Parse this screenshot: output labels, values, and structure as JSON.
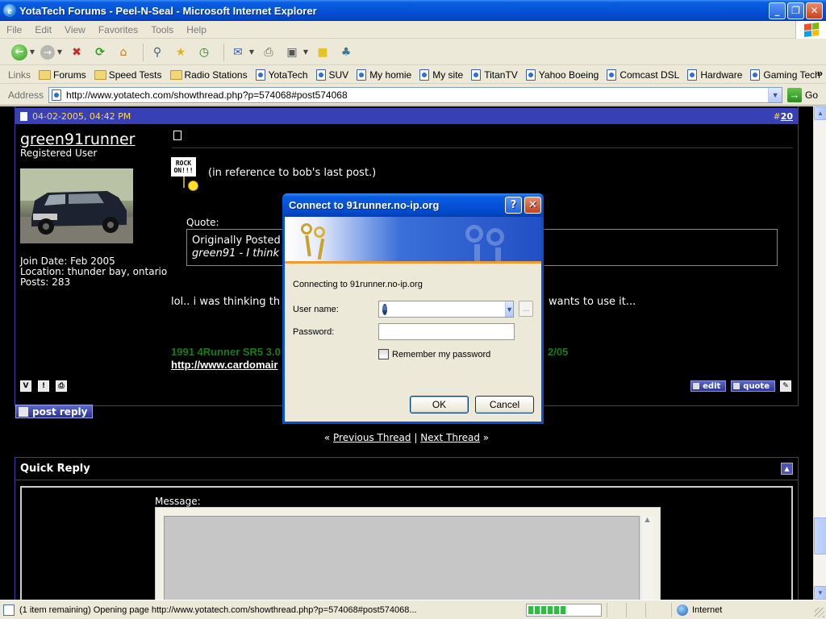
{
  "window": {
    "title": "YotaTech Forums - Peel-N-Seal - Microsoft Internet Explorer"
  },
  "menu": [
    "File",
    "Edit",
    "View",
    "Favorites",
    "Tools",
    "Help"
  ],
  "links_bar": {
    "label": "Links",
    "items": [
      {
        "label": "Forums",
        "icon": "folder-icon"
      },
      {
        "label": "Speed Tests",
        "icon": "folder-icon"
      },
      {
        "label": "Radio Stations",
        "icon": "folder-icon"
      },
      {
        "label": "YotaTech",
        "icon": "page-icon"
      },
      {
        "label": "SUV",
        "icon": "page-icon"
      },
      {
        "label": "My homie",
        "icon": "page-icon"
      },
      {
        "label": "My site",
        "icon": "page-icon"
      },
      {
        "label": "TitanTV",
        "icon": "page-icon"
      },
      {
        "label": "Yahoo Boeing",
        "icon": "page-icon"
      },
      {
        "label": "Comcast DSL",
        "icon": "page-icon"
      },
      {
        "label": "Hardware",
        "icon": "page-icon"
      },
      {
        "label": "Gaming Tech",
        "icon": "page-icon"
      }
    ]
  },
  "address_bar": {
    "label": "Address",
    "url": "http://www.yotatech.com/showthread.php?p=574068#post574068",
    "go_label": "Go"
  },
  "post": {
    "date": "04-02-2005, 04:42 PM",
    "number_prefix": "#",
    "number": "20",
    "username": "green91runner",
    "user_title": "Registered User",
    "join_date": "Join Date: Feb 2005",
    "location": "Location: thunder bay, ontario",
    "posts": "Posts: 283",
    "smiley_text": "ROCK ON!!!",
    "reference_text": "(in reference to bob's last post.)",
    "quote_label": "Quote:",
    "quote_line1": "Originally Posted",
    "quote_line2": "green91 - I think",
    "reply_text": "lol.. i was thinking th",
    "reply_tail": "wants to use it...",
    "sig_line1": "1991 4Runner SR5 3.0",
    "sig_line1_tail": "2/05",
    "sig_link": "http://www.cardomair",
    "edit_label": "edit",
    "quote_button_label": "quote"
  },
  "post_reply_label": "post reply",
  "thread_nav": {
    "prev_prefix": "«",
    "prev": "Previous Thread",
    "divider": "|",
    "next": "Next Thread",
    "next_suffix": "»"
  },
  "quick_reply": {
    "title": "Quick Reply",
    "message_label": "Message:"
  },
  "status_bar": {
    "text": "(1 item remaining) Opening page http://www.yotatech.com/showthread.php?p=574068#post574068...",
    "progress": 0.55,
    "zone": "Internet"
  },
  "dialog": {
    "title": "Connect to 91runner.no-ip.org",
    "connecting": "Connecting to 91runner.no-ip.org",
    "username_label": "User name:",
    "username_value": "",
    "password_label": "Password:",
    "remember_label": "Remember my password",
    "ok": "OK",
    "cancel": "Cancel",
    "browse": "..."
  }
}
